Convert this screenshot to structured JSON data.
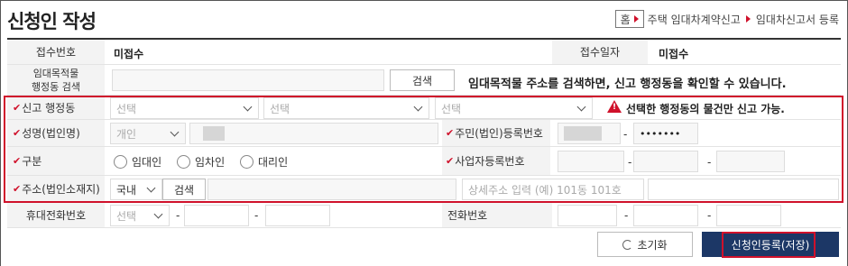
{
  "header": {
    "title": "신청인 작성",
    "breadcrumb": {
      "home": "홈",
      "level1": "주택 임대차계약신고",
      "level2": "임대차신고서 등록"
    }
  },
  "form": {
    "receipt_no": {
      "label": "접수번호",
      "value": "미접수"
    },
    "receipt_date": {
      "label": "접수일자",
      "value": "미접수"
    },
    "property_district": {
      "label_line1": "임대목적물",
      "label_line2": "행정동 검색",
      "search_button": "검색",
      "notice": "임대목적물 주소를 검색하면, 신고 행정동을 확인할 수 있습니다."
    },
    "report_district": {
      "label": "신고 행정동",
      "select1": "선택",
      "select2": "선택",
      "select3": "선택",
      "warning": "선택한 행정동의 물건만 신고 가능."
    },
    "name": {
      "label": "성명(법인명)",
      "type_select": "개인"
    },
    "resident_no": {
      "label": "주민(법인)등록번호",
      "masked": "•••••••",
      "dash": "-"
    },
    "category": {
      "label": "구분",
      "options": [
        "임대인",
        "임차인",
        "대리인"
      ]
    },
    "business_no": {
      "label": "사업자등록번호",
      "dash1": "-",
      "dash2": "-"
    },
    "address": {
      "label": "주소(법인소재지)",
      "country_select": "국내",
      "search_button": "검색",
      "detail_placeholder": "상세주소 입력 (예) 101동 101호"
    },
    "mobile": {
      "label": "휴대전화번호",
      "select": "선택",
      "dash1": "-",
      "dash2": "-"
    },
    "phone": {
      "label": "전화번호",
      "dash1": "-",
      "dash2": "-"
    }
  },
  "actions": {
    "reset": "초기화",
    "save": "신청인등록(저장)"
  },
  "colors": {
    "accent": "#d0112b",
    "primary": "#1c3766"
  }
}
